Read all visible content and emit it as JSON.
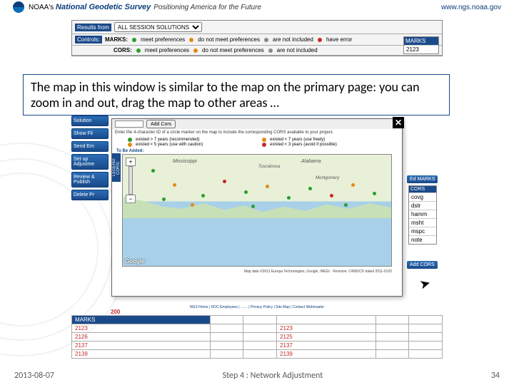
{
  "header": {
    "org": "NOAA's",
    "title": "National Geodetic Survey",
    "tagline": "Positioning America for the Future",
    "url": "www.ngs.noaa.gov"
  },
  "results": {
    "label": "Results from",
    "selected": "ALL SESSION SOLUTIONS"
  },
  "controls_label": "Controls:",
  "marks_row": {
    "label": "MARKS:",
    "meet": "meet preferences",
    "notmeet": "do not meet preferences",
    "notincl": "are not included",
    "err": "have error"
  },
  "cors_row": {
    "label": "CORS:",
    "meet": "meet preferences",
    "notmeet": "do not meet preferences",
    "notincl": "are not included"
  },
  "marks_box": {
    "header": "MARKS",
    "items": [
      "2123"
    ]
  },
  "sidebar": {
    "items": [
      "Solution",
      "Show Fil",
      "Send Em",
      "Set up Adjustme",
      "Review & Publish",
      "Delete Pr"
    ]
  },
  "callout": "The map in this window is similar to the map on the primary page: you can zoom in and out, drag the map to other areas …",
  "modal": {
    "addcors_btn": "Add Cors",
    "hint": "Enter the 4-character ID of a circle marker on the map to include the corresponding CORS available to your project.",
    "legend_label": "LEGEND CORS:",
    "legend": {
      "a": "existed > 7 years (recommended)",
      "b": "existed < 7 years (use freely)",
      "c": "existed < 5 years (use with caution)",
      "d": "existed < 3 years (avoid if possible)"
    },
    "tobeadded": "To Be Added:",
    "map_labels": {
      "ms": "Mississippi",
      "al": "Alabama",
      "tusc": "Tuscaloosa",
      "mont": "Montgomery"
    },
    "google": "Google",
    "footer": "Map data ©2011 Europa Technologies, Google, INEGI · Revision: C4565CD dated 2011-0120"
  },
  "cors_side": {
    "header": "CORS",
    "items": [
      "covg",
      "dstr",
      "hamm",
      "msht",
      "mspc",
      "note"
    ]
  },
  "edmarks_btn": "Ed MARKS",
  "addcors_btn2": "Add CORS",
  "red200": "200",
  "bottom_table": {
    "header": "MARKS",
    "rows": [
      [
        "2123",
        "2123"
      ],
      [
        "2126",
        "2125"
      ],
      [
        "2137",
        "2137"
      ],
      [
        "2139",
        "2139"
      ]
    ]
  },
  "footer_links": "NGS Home  |  DOC Employees  |  ……  |  Privacy Policy  |  Site Map  |  Contact Webmaster",
  "slide": {
    "left": "2013-08-07",
    "center": "Step 4 : Network Adjustment",
    "right": "34"
  },
  "colors": {
    "green": "#2a9d2a",
    "orange": "#e08a1a",
    "red": "#c62828",
    "brand": "#1a4a8a"
  }
}
